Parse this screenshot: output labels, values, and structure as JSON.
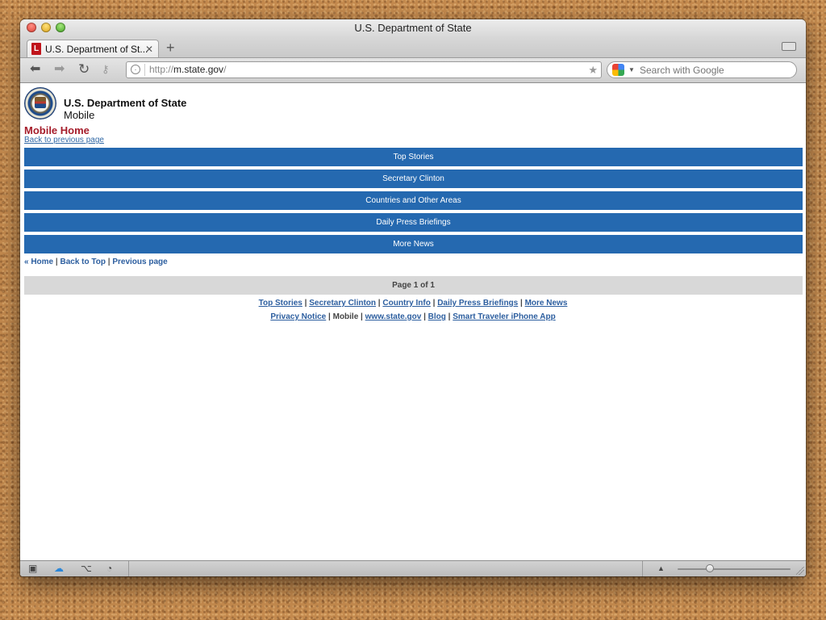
{
  "window": {
    "title": "U.S. Department of State"
  },
  "tabs": [
    {
      "label": "U.S. Department of St..."
    }
  ],
  "toolbar": {
    "url_prefix": "http://",
    "url_host": "m.state.gov",
    "url_suffix": "/",
    "search_placeholder": "Search with Google"
  },
  "page": {
    "org_name": "U.S. Department of State",
    "org_sub": "Mobile",
    "heading": "Mobile Home",
    "back_link": "Back to previous page",
    "menu": [
      "Top Stories",
      "Secretary Clinton",
      "Countries and Other Areas",
      "Daily Press Briefings",
      "More News"
    ],
    "quicknav": {
      "home": "« Home",
      "sep": " | ",
      "back_to_top": "Back to Top",
      "previous": "Previous page"
    },
    "pager": "Page 1 of 1",
    "footer_links": {
      "top_stories": "Top Stories",
      "secretary_clinton": "Secretary Clinton",
      "country_info": "Country Info",
      "daily_press_briefings": "Daily Press Briefings",
      "more_news": "More News",
      "privacy_notice": "Privacy Notice",
      "mobile": "Mobile",
      "website": "www.state.gov",
      "blog": "Blog",
      "smart_traveler": "Smart Traveler iPhone App",
      "sep": " | "
    }
  },
  "icons": {
    "back": "back-arrow-icon",
    "forward": "forward-arrow-icon",
    "reload": "reload-icon",
    "key": "key-icon",
    "star": "bookmark-star-icon"
  },
  "colors": {
    "menu_blue": "#2569b0",
    "heading_red": "#a51c2a",
    "link_blue": "#2c5e9f",
    "pager_gray": "#d8d8d8"
  }
}
